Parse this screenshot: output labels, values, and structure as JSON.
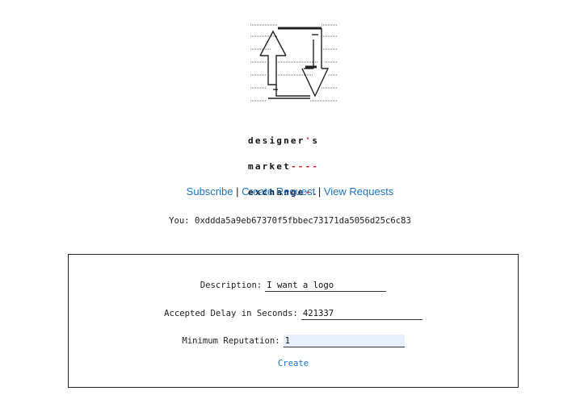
{
  "brand": {
    "line1": "designer",
    "line1_accent": "'",
    "line1_end": "s",
    "line2": "market",
    "line2_accent": "----",
    "line3": "exchange",
    "line3_accent": "-."
  },
  "nav": {
    "subscribe": "Subscribe",
    "create_request": "Create Request",
    "view_requests": "View Requests",
    "separator": "|"
  },
  "you": {
    "label": "You:",
    "address": "0xddda5a9eb67370f5fbbec73171da5056d25c6c83"
  },
  "form": {
    "description_label": "Description:",
    "description_value": "I want a logo",
    "delay_label": "Accepted Delay in Seconds:",
    "delay_value": "421337",
    "reputation_label": "Minimum Reputation:",
    "reputation_value": "1",
    "create_label": "Create"
  },
  "colors": {
    "link": "#1a73c9",
    "accent": "#d0202a",
    "focused_input": "#e8f0fe"
  }
}
